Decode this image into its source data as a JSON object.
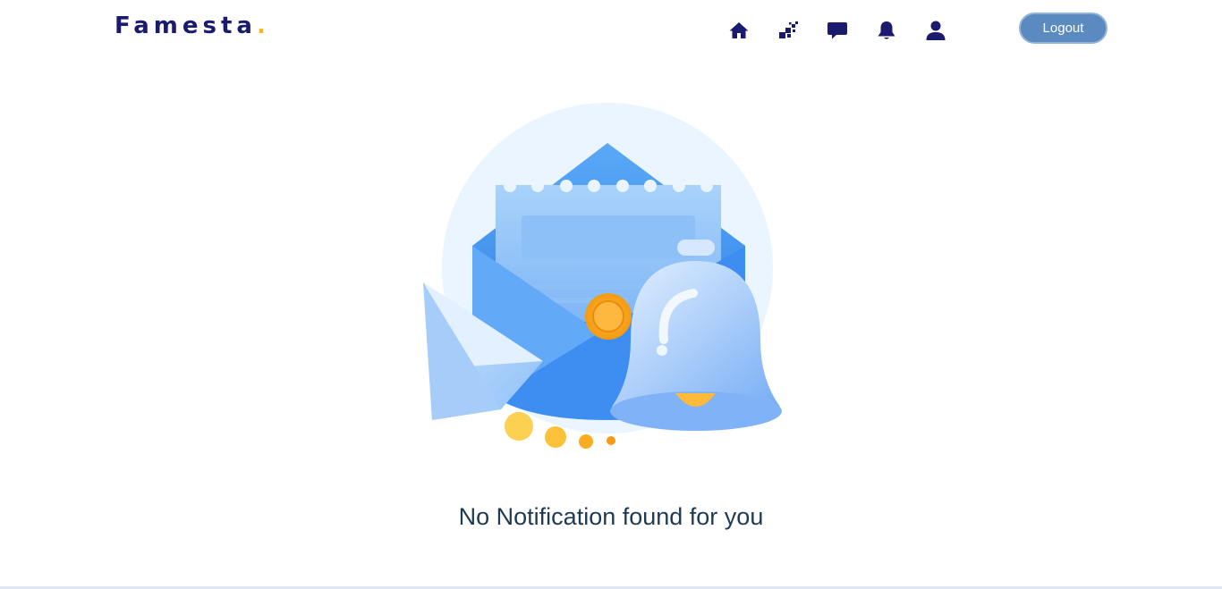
{
  "brand": {
    "name": "Famesta",
    "dot": "."
  },
  "nav": [
    {
      "name": "home-icon",
      "label": "Home"
    },
    {
      "name": "grid-icon",
      "label": "Explore"
    },
    {
      "name": "chat-icon",
      "label": "Messages"
    },
    {
      "name": "bell-icon",
      "label": "Notifications"
    },
    {
      "name": "user-icon",
      "label": "Profile"
    }
  ],
  "logout_label": "Logout",
  "empty_state": {
    "message": "No Notification found for you"
  },
  "colors": {
    "brand_navy": "#1a1a6e",
    "brand_accent": "#f5b71c",
    "button_bg": "#5a8ac0",
    "text": "#1f3a55"
  }
}
